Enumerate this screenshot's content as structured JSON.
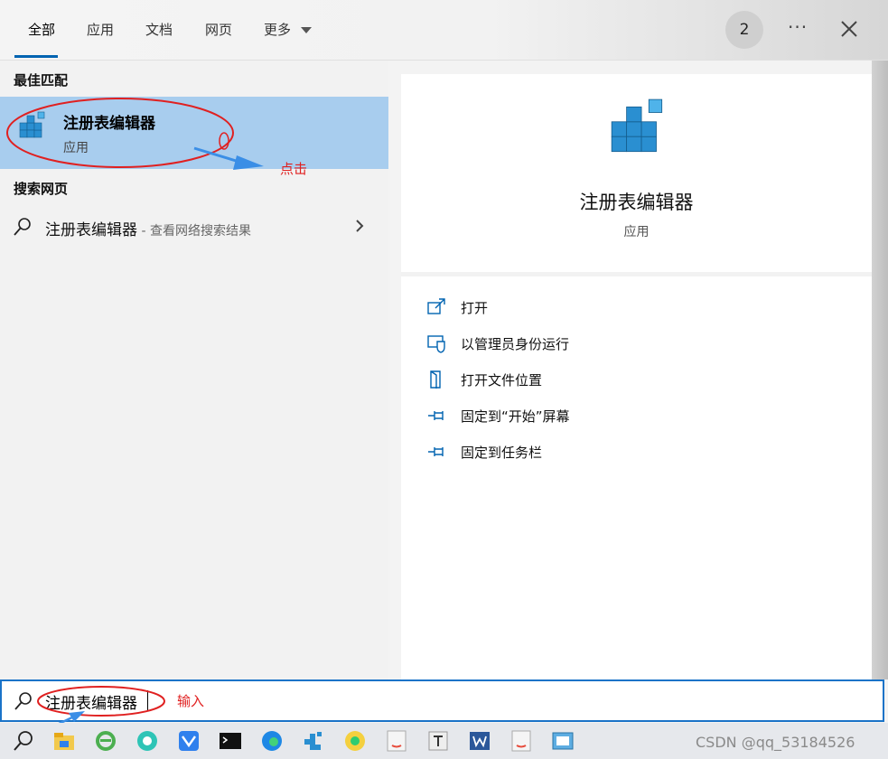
{
  "tabs": [
    {
      "label": "全部"
    },
    {
      "label": "应用"
    },
    {
      "label": "文档"
    },
    {
      "label": "网页"
    },
    {
      "label": "更多"
    }
  ],
  "header": {
    "badge": "2",
    "more": "···"
  },
  "best_match": {
    "heading": "最佳匹配",
    "title": "注册表编辑器",
    "subtitle": "应用"
  },
  "web": {
    "heading": "搜索网页",
    "query": "注册表编辑器",
    "hint": " - 查看网络搜索结果"
  },
  "details": {
    "title": "注册表编辑器",
    "type": "应用",
    "actions": [
      {
        "label": "打开",
        "icon": "open-icon"
      },
      {
        "label": "以管理员身份运行",
        "icon": "shield-icon"
      },
      {
        "label": "打开文件位置",
        "icon": "file-location-icon"
      },
      {
        "label": "固定到“开始”屏幕",
        "icon": "pin-icon"
      },
      {
        "label": "固定到任务栏",
        "icon": "pin-icon"
      }
    ]
  },
  "search": {
    "value": "注册表编辑器"
  },
  "annotations": {
    "click": "点击",
    "input": "输入"
  },
  "watermark": "CSDN @qq_53184526",
  "colors": {
    "accent": "#0063b1",
    "selected_row": "#a8cdee",
    "annotation_red": "#e02020"
  }
}
